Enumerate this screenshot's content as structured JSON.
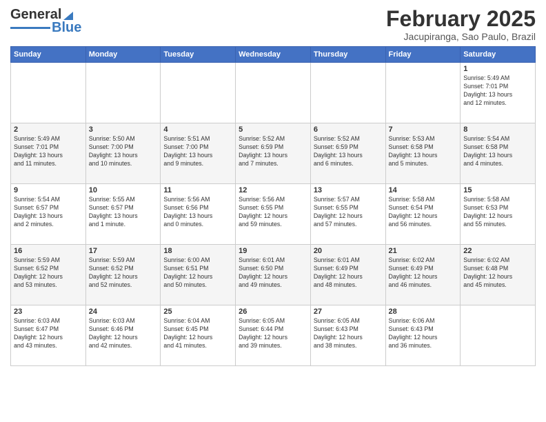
{
  "logo": {
    "general": "General",
    "blue": "Blue"
  },
  "header": {
    "month_title": "February 2025",
    "location": "Jacupiranga, Sao Paulo, Brazil"
  },
  "weekdays": [
    "Sunday",
    "Monday",
    "Tuesday",
    "Wednesday",
    "Thursday",
    "Friday",
    "Saturday"
  ],
  "weeks": [
    [
      {
        "day": "",
        "info": ""
      },
      {
        "day": "",
        "info": ""
      },
      {
        "day": "",
        "info": ""
      },
      {
        "day": "",
        "info": ""
      },
      {
        "day": "",
        "info": ""
      },
      {
        "day": "",
        "info": ""
      },
      {
        "day": "1",
        "info": "Sunrise: 5:49 AM\nSunset: 7:01 PM\nDaylight: 13 hours\nand 12 minutes."
      }
    ],
    [
      {
        "day": "2",
        "info": "Sunrise: 5:49 AM\nSunset: 7:01 PM\nDaylight: 13 hours\nand 11 minutes."
      },
      {
        "day": "3",
        "info": "Sunrise: 5:50 AM\nSunset: 7:00 PM\nDaylight: 13 hours\nand 10 minutes."
      },
      {
        "day": "4",
        "info": "Sunrise: 5:51 AM\nSunset: 7:00 PM\nDaylight: 13 hours\nand 9 minutes."
      },
      {
        "day": "5",
        "info": "Sunrise: 5:52 AM\nSunset: 6:59 PM\nDaylight: 13 hours\nand 7 minutes."
      },
      {
        "day": "6",
        "info": "Sunrise: 5:52 AM\nSunset: 6:59 PM\nDaylight: 13 hours\nand 6 minutes."
      },
      {
        "day": "7",
        "info": "Sunrise: 5:53 AM\nSunset: 6:58 PM\nDaylight: 13 hours\nand 5 minutes."
      },
      {
        "day": "8",
        "info": "Sunrise: 5:54 AM\nSunset: 6:58 PM\nDaylight: 13 hours\nand 4 minutes."
      }
    ],
    [
      {
        "day": "9",
        "info": "Sunrise: 5:54 AM\nSunset: 6:57 PM\nDaylight: 13 hours\nand 2 minutes."
      },
      {
        "day": "10",
        "info": "Sunrise: 5:55 AM\nSunset: 6:57 PM\nDaylight: 13 hours\nand 1 minute."
      },
      {
        "day": "11",
        "info": "Sunrise: 5:56 AM\nSunset: 6:56 PM\nDaylight: 13 hours\nand 0 minutes."
      },
      {
        "day": "12",
        "info": "Sunrise: 5:56 AM\nSunset: 6:55 PM\nDaylight: 12 hours\nand 59 minutes."
      },
      {
        "day": "13",
        "info": "Sunrise: 5:57 AM\nSunset: 6:55 PM\nDaylight: 12 hours\nand 57 minutes."
      },
      {
        "day": "14",
        "info": "Sunrise: 5:58 AM\nSunset: 6:54 PM\nDaylight: 12 hours\nand 56 minutes."
      },
      {
        "day": "15",
        "info": "Sunrise: 5:58 AM\nSunset: 6:53 PM\nDaylight: 12 hours\nand 55 minutes."
      }
    ],
    [
      {
        "day": "16",
        "info": "Sunrise: 5:59 AM\nSunset: 6:52 PM\nDaylight: 12 hours\nand 53 minutes."
      },
      {
        "day": "17",
        "info": "Sunrise: 5:59 AM\nSunset: 6:52 PM\nDaylight: 12 hours\nand 52 minutes."
      },
      {
        "day": "18",
        "info": "Sunrise: 6:00 AM\nSunset: 6:51 PM\nDaylight: 12 hours\nand 50 minutes."
      },
      {
        "day": "19",
        "info": "Sunrise: 6:01 AM\nSunset: 6:50 PM\nDaylight: 12 hours\nand 49 minutes."
      },
      {
        "day": "20",
        "info": "Sunrise: 6:01 AM\nSunset: 6:49 PM\nDaylight: 12 hours\nand 48 minutes."
      },
      {
        "day": "21",
        "info": "Sunrise: 6:02 AM\nSunset: 6:49 PM\nDaylight: 12 hours\nand 46 minutes."
      },
      {
        "day": "22",
        "info": "Sunrise: 6:02 AM\nSunset: 6:48 PM\nDaylight: 12 hours\nand 45 minutes."
      }
    ],
    [
      {
        "day": "23",
        "info": "Sunrise: 6:03 AM\nSunset: 6:47 PM\nDaylight: 12 hours\nand 43 minutes."
      },
      {
        "day": "24",
        "info": "Sunrise: 6:03 AM\nSunset: 6:46 PM\nDaylight: 12 hours\nand 42 minutes."
      },
      {
        "day": "25",
        "info": "Sunrise: 6:04 AM\nSunset: 6:45 PM\nDaylight: 12 hours\nand 41 minutes."
      },
      {
        "day": "26",
        "info": "Sunrise: 6:05 AM\nSunset: 6:44 PM\nDaylight: 12 hours\nand 39 minutes."
      },
      {
        "day": "27",
        "info": "Sunrise: 6:05 AM\nSunset: 6:43 PM\nDaylight: 12 hours\nand 38 minutes."
      },
      {
        "day": "28",
        "info": "Sunrise: 6:06 AM\nSunset: 6:43 PM\nDaylight: 12 hours\nand 36 minutes."
      },
      {
        "day": "",
        "info": ""
      }
    ]
  ]
}
